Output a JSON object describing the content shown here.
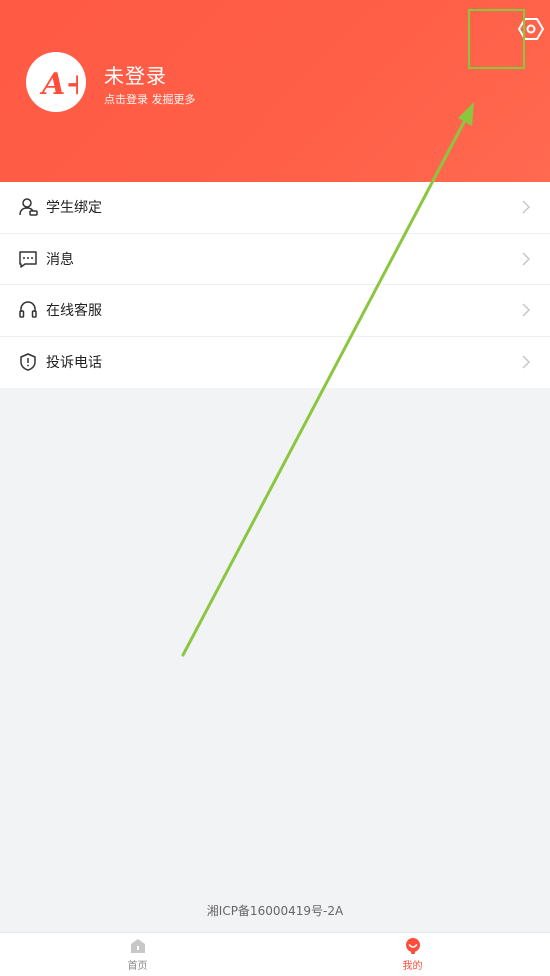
{
  "header": {
    "title": "未登录",
    "subtitle": "点击登录 发掘更多",
    "logo_text": "A+",
    "bg_color": "#ff5a44",
    "settings_icon": "settings-icon"
  },
  "menu": {
    "items": [
      {
        "label": "学生绑定",
        "icon": "user-bind-icon"
      },
      {
        "label": "消息",
        "icon": "message-icon"
      },
      {
        "label": "在线客服",
        "icon": "headset-icon"
      },
      {
        "label": "投诉电话",
        "icon": "shield-icon"
      }
    ]
  },
  "footer": {
    "icp": "湘ICP备16000419号-2A"
  },
  "tabbar": {
    "tabs": [
      {
        "label": "首页",
        "icon": "home-icon",
        "active": false
      },
      {
        "label": "我的",
        "icon": "profile-icon",
        "active": true
      }
    ],
    "active_color": "#ff4d3a"
  },
  "annotation": {
    "color": "#8cc63f"
  }
}
